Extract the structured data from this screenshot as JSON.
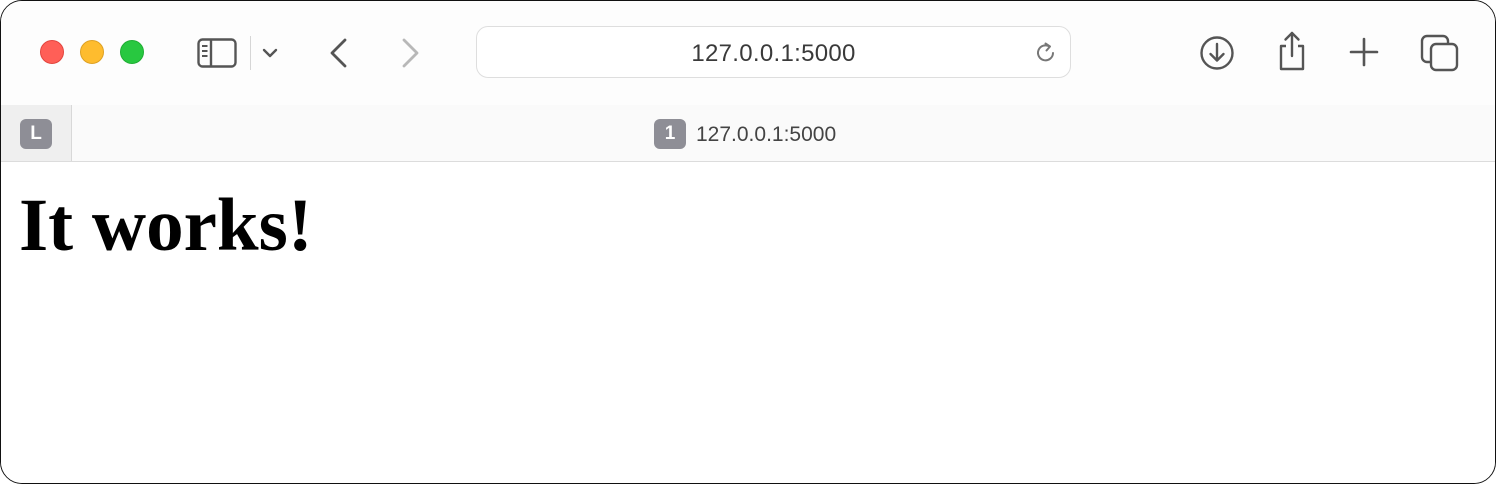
{
  "browser": {
    "address_bar": {
      "url": "127.0.0.1:5000"
    },
    "tabs": [
      {
        "badge": "L",
        "pinned": true
      },
      {
        "badge": "1",
        "title": "127.0.0.1:5000",
        "active": true
      }
    ],
    "colors": {
      "close": "#ff5f57",
      "minimize": "#febc2e",
      "maximize": "#28c840",
      "badge": "#8e8e96"
    }
  },
  "page": {
    "heading": "It works!"
  }
}
